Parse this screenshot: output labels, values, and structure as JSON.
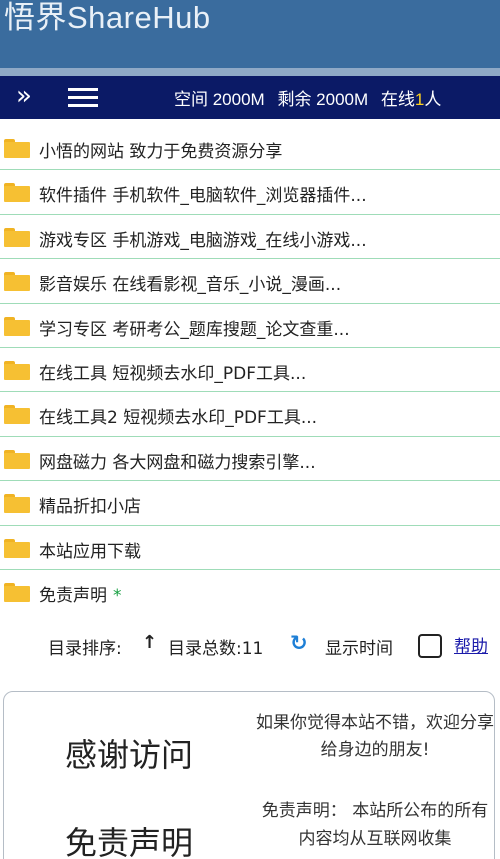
{
  "header": {
    "title": "悟界ShareHub"
  },
  "toolbar": {
    "expand_icon": "double-chevron-right-icon",
    "menu_icon": "hamburger-menu-icon",
    "space_text": "空间 2000M",
    "remaining_text": "剩余 2000M",
    "online_label": "在线",
    "online_count": "1",
    "online_unit": "人"
  },
  "folders": [
    {
      "label": "小悟的网站 致力于免费资源分享"
    },
    {
      "label": "软件插件 手机软件_电脑软件_浏览器插件..."
    },
    {
      "label": "游戏专区 手机游戏_电脑游戏_在线小游戏..."
    },
    {
      "label": "影音娱乐 在线看影视_音乐_小说_漫画..."
    },
    {
      "label": "学习专区 考研考公_题库搜题_论文查重..."
    },
    {
      "label": "在线工具 短视频去水印_PDF工具..."
    },
    {
      "label": "在线工具2 短视频去水印_PDF工具..."
    },
    {
      "label": "网盘磁力 各大网盘和磁力搜索引擎..."
    },
    {
      "label": "精品折扣小店"
    },
    {
      "label": "本站应用下载"
    },
    {
      "label": "免责声明",
      "star": "*"
    }
  ],
  "sortbar": {
    "sort_label": "目录排序:",
    "sort_arrow": "↑",
    "count_text": "目录总数:11",
    "refresh_icon": "↻",
    "time_label": "显示时间",
    "help_label": "帮助"
  },
  "card": {
    "heading1": "感谢访问",
    "text1": "如果你觉得本站不错，欢迎分享给身边的朋友!",
    "heading2": "免责声明",
    "text2": "免责声明： 本站所公布的所有内容均从互联网收集"
  },
  "colors": {
    "header_bg": "#3a6c9e",
    "toolbar_bg": "#0b1a66",
    "folder": "#f6c033",
    "divider": "#9fdcb8",
    "online_count": "#ffd21f",
    "star": "#18a043",
    "link": "#1a1aaa"
  }
}
